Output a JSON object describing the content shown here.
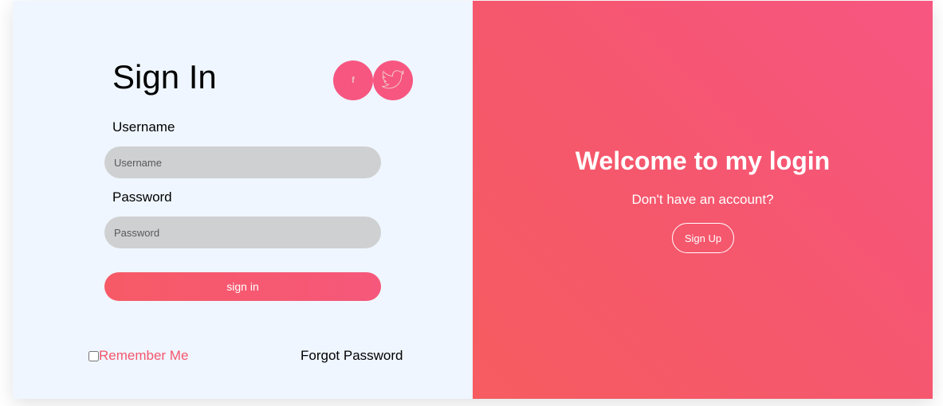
{
  "signin": {
    "title": "Sign In",
    "social": [
      {
        "icon": "facebook-icon",
        "glyph": "f"
      },
      {
        "icon": "twitter-icon"
      }
    ],
    "username_label": "Username",
    "username_placeholder": "Username",
    "password_label": "Password",
    "password_placeholder": "Password",
    "submit_label": "sign in",
    "remember_label": "Remember Me",
    "forgot_label": "Forgot Password"
  },
  "welcome": {
    "title": "Welcome to my login",
    "subtitle": "Don't have an account?",
    "signup_label": "Sign Up"
  },
  "colors": {
    "accent": "#f5576c",
    "accent_pink": "#f75681",
    "panel_bg": "#eff6ff",
    "input_bg": "#cfd0d1"
  }
}
